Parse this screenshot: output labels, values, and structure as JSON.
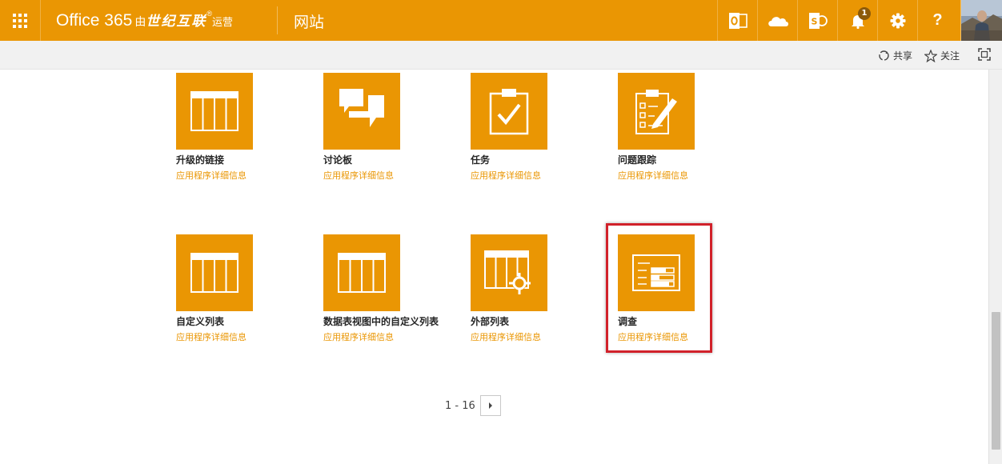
{
  "suite_bar": {
    "app_name": "Office 365",
    "by_label": "由",
    "partner": "世纪互联",
    "partner_mark": "®",
    "operated_label": "运营",
    "site_title": "网站",
    "notification_count": "1",
    "icons": [
      "outlook-icon",
      "onedrive-icon",
      "sharepoint-icon",
      "bell-icon",
      "gear-icon",
      "help-icon"
    ],
    "help_glyph": "?"
  },
  "command_bar": {
    "share_label": "共享",
    "follow_label": "关注"
  },
  "tiles": [
    {
      "name": "升级的链接",
      "link": "应用程序详细信息",
      "icon": "list-table-icon"
    },
    {
      "name": "讨论板",
      "link": "应用程序详细信息",
      "icon": "discussion-icon"
    },
    {
      "name": "任务",
      "link": "应用程序详细信息",
      "icon": "task-clipboard-icon"
    },
    {
      "name": "问题跟踪",
      "link": "应用程序详细信息",
      "icon": "issue-tracking-icon"
    },
    {
      "name": "自定义列表",
      "link": "应用程序详细信息",
      "icon": "list-table-icon"
    },
    {
      "name": "数据表视图中的自定义列表",
      "link": "应用程序详细信息",
      "icon": "list-table-icon"
    },
    {
      "name": "外部列表",
      "link": "应用程序详细信息",
      "icon": "external-list-icon"
    },
    {
      "name": "调查",
      "link": "应用程序详细信息",
      "icon": "survey-icon"
    }
  ],
  "pager": {
    "range": "1 - 16"
  },
  "colors": {
    "accent": "#ea9603",
    "highlight": "#d1212a"
  }
}
